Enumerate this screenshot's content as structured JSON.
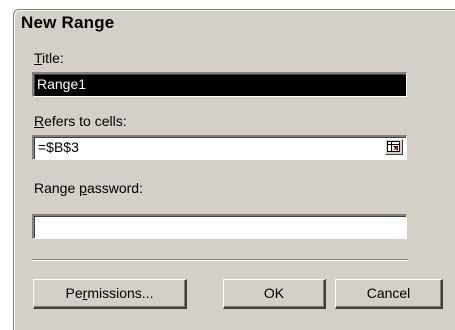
{
  "window": {
    "title": "New Range"
  },
  "title_field": {
    "label_prefix": "",
    "label_mnemonic": "T",
    "label_rest": "itle:",
    "value": "Range1"
  },
  "refers_field": {
    "label_mnemonic": "R",
    "label_rest": "efers to cells:",
    "value": "=$B$3",
    "collapse_icon": "range-collapse-icon"
  },
  "password_field": {
    "label_prefix": "Range ",
    "label_mnemonic": "p",
    "label_rest": "assword:",
    "value": ""
  },
  "buttons": {
    "permissions_prefix": "Pe",
    "permissions_mnemonic": "r",
    "permissions_rest": "missions...",
    "ok": "OK",
    "cancel": "Cancel"
  },
  "colors": {
    "dialog_face": "#d4d0c8",
    "selection": "#000000"
  }
}
